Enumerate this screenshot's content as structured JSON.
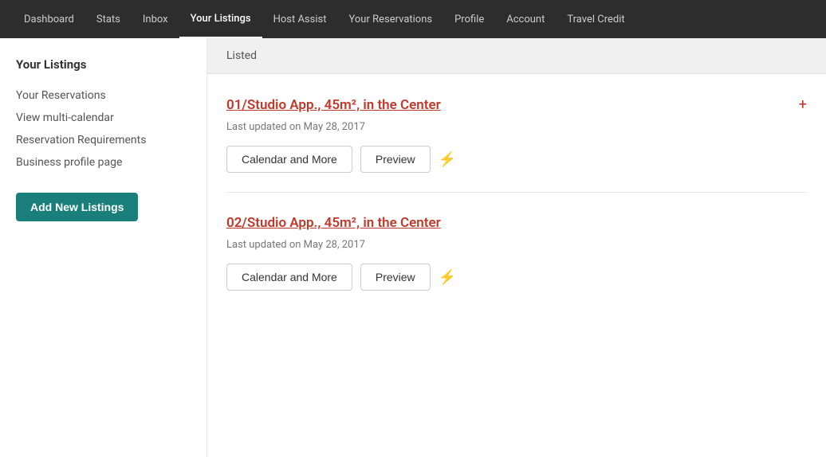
{
  "nav": {
    "items": [
      {
        "label": "Dashboard",
        "active": false
      },
      {
        "label": "Stats",
        "active": false
      },
      {
        "label": "Inbox",
        "active": false
      },
      {
        "label": "Your Listings",
        "active": true
      },
      {
        "label": "Host Assist",
        "active": false
      },
      {
        "label": "Your Reservations",
        "active": false
      },
      {
        "label": "Profile",
        "active": false
      },
      {
        "label": "Account",
        "active": false
      },
      {
        "label": "Travel Credit",
        "active": false
      }
    ]
  },
  "sidebar": {
    "title": "Your Listings",
    "links": [
      {
        "label": "Your Reservations"
      },
      {
        "label": "View multi-calendar"
      },
      {
        "label": "Reservation Requirements"
      },
      {
        "label": "Business profile page"
      }
    ],
    "add_button_label": "Add New Listings"
  },
  "main": {
    "listed_header": "Listed",
    "listings": [
      {
        "id": "listing-1",
        "title": "01/Studio App., 45m², in the Center",
        "last_updated": "Last updated on May 28, 2017",
        "calendar_button": "Calendar and More",
        "preview_button": "Preview"
      },
      {
        "id": "listing-2",
        "title": "02/Studio App., 45m², in the Center",
        "last_updated": "Last updated on May 28, 2017",
        "calendar_button": "Calendar and More",
        "preview_button": "Preview"
      }
    ]
  }
}
